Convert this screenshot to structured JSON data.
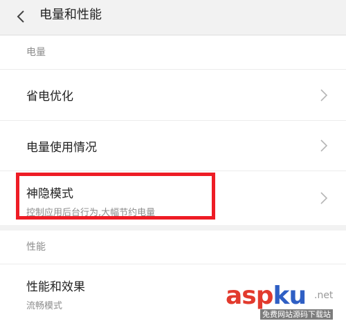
{
  "header": {
    "title": "电量和性能",
    "back_icon": "chevron-left-icon"
  },
  "sections": {
    "power": {
      "label": "电量",
      "items": [
        {
          "title": "省电优化"
        },
        {
          "title": "电量使用情况"
        },
        {
          "title": "神隐模式",
          "subtitle": "控制应用后台行为,大幅节约电量"
        }
      ]
    },
    "performance": {
      "label": "性能",
      "items": [
        {
          "title": "性能和效果",
          "subtitle": "流畅模式"
        }
      ]
    }
  },
  "watermark": {
    "part1": "asp",
    "part2": "ku",
    "suffix": ".net",
    "tagline": "免费网站源码下载站"
  },
  "colors": {
    "highlight": "#ee1c25",
    "background": "#f2f2f2",
    "card": "#ffffff",
    "secondary_text": "#8c8c8c"
  }
}
